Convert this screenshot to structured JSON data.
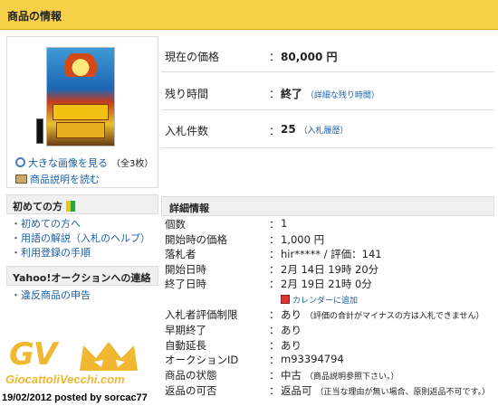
{
  "header": {
    "title": "商品の情報"
  },
  "product": {
    "large_image_link": "大きな画像を見る",
    "image_count": "（全3枚）",
    "description_link": "商品説明を読む"
  },
  "beginner": {
    "title": "初めての方",
    "links": [
      "初めての方へ",
      "用語の解説（入札のヘルプ）",
      "利用登録の手順"
    ]
  },
  "yahoo_contact": {
    "title": "Yahoo!オークションへの連絡",
    "links": [
      "違反商品の申告"
    ]
  },
  "summary": {
    "price_label": "現在の価格",
    "price_value": "80,000 円",
    "time_label": "残り時間",
    "time_value": "終了",
    "time_link": "（詳細な残り時間）",
    "bids_label": "入札件数",
    "bids_value": "25",
    "bids_link": "（入札履歴）",
    "colon": "："
  },
  "details": {
    "title": "詳細情報",
    "rows": [
      {
        "label": "個数",
        "value": "1",
        "note": ""
      },
      {
        "label": "開始時の価格",
        "value": "1,000 円",
        "note": ""
      },
      {
        "label": "落札者",
        "value": "hir***** / 評価：141",
        "note": ""
      },
      {
        "label": "開始日時",
        "value": "2月 14日 19時 20分",
        "note": ""
      },
      {
        "label": "終了日時",
        "value": "2月 19日 21時 0分",
        "note": ""
      },
      {
        "label": "入札者評価制限",
        "value": "あり",
        "note": "（評価の合計がマイナスの方は入札できません）"
      },
      {
        "label": "早期終了",
        "value": "あり",
        "note": ""
      },
      {
        "label": "自動延長",
        "value": "あり",
        "note": ""
      },
      {
        "label": "オークションID",
        "value": "m93394794",
        "note": ""
      },
      {
        "label": "商品の状態",
        "value": "中古",
        "note": "（商品説明参照下さい。）"
      },
      {
        "label": "返品の可否",
        "value": "返品可",
        "note": "（正当な理由が無い場合、原則返品不可です。）"
      }
    ],
    "calendar_link": "カレンダーに追加"
  },
  "watermark": {
    "logo": "GV",
    "site": "GiocattoliVecchi.com",
    "credit": "19/02/2012 posted by sorcac77"
  },
  "colors": {
    "header_bg": "#f7d04a",
    "link": "#1a5fa8",
    "watermark": "#f0b830"
  }
}
